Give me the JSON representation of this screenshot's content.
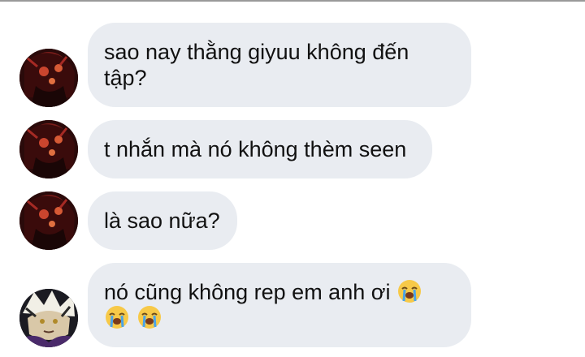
{
  "messages": [
    {
      "lines": [
        "sao nay thằng giyuu không đến",
        "tập?"
      ],
      "avatar": "red-demon-avatar"
    },
    {
      "lines": [
        "t nhắn mà nó không thèm seen"
      ],
      "avatar": "red-demon-avatar"
    },
    {
      "lines": [
        "là sao nữa?"
      ],
      "avatar": "red-demon-avatar"
    },
    {
      "lines": [
        "nó cũng không rep em anh ơi"
      ],
      "emoji_inline": "loudly-crying-face",
      "emoji_line_count": 2,
      "avatar": "dark-haired-avatar"
    }
  ],
  "colors": {
    "bubble_bg": "#e9ecf1",
    "text": "#111111",
    "divider": "#9a9a9a"
  }
}
